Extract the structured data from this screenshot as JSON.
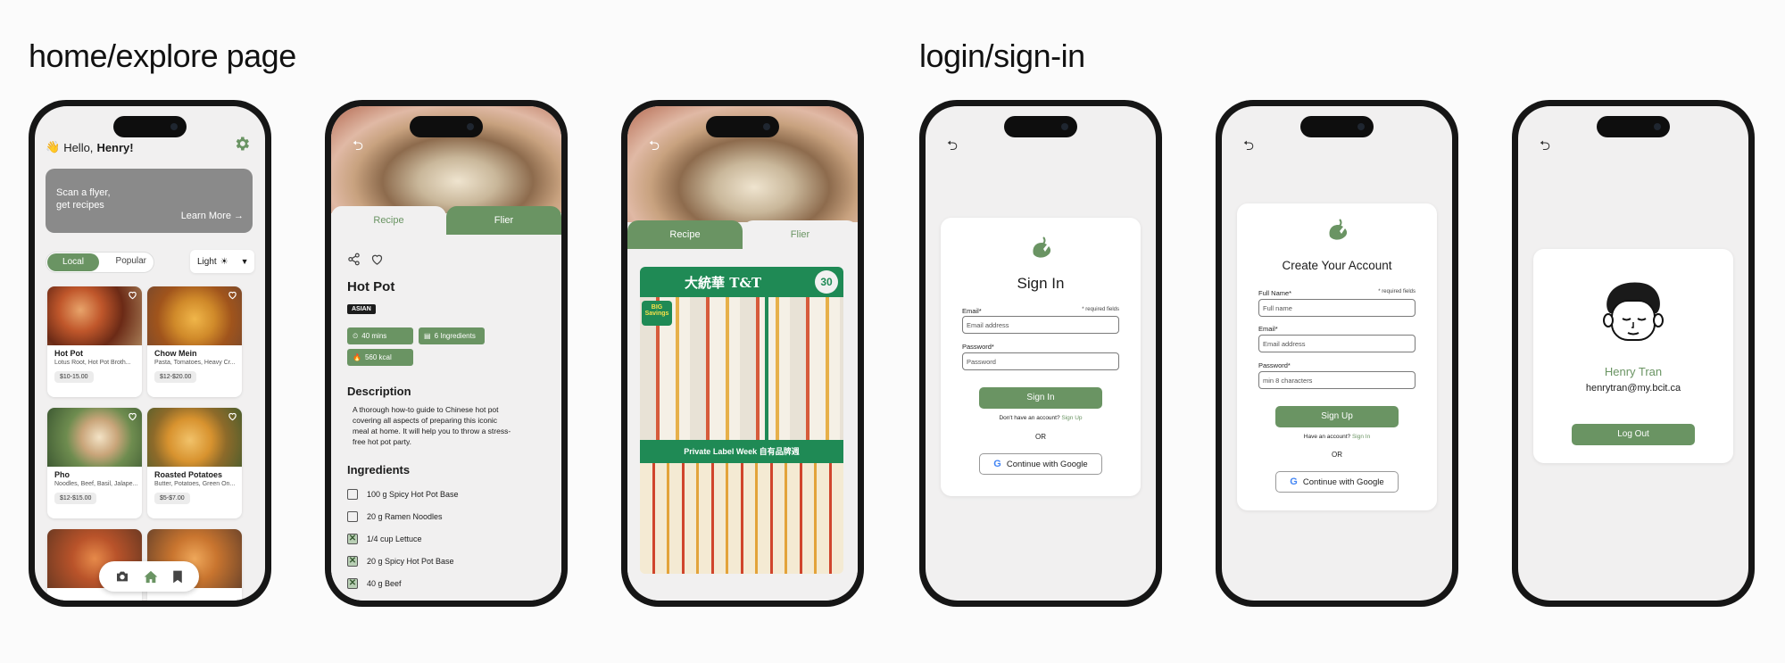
{
  "sections": {
    "home_title": "home/explore page",
    "login_title": "login/sign-in"
  },
  "colors": {
    "accent": "#6a9463",
    "screen_bg": "#f1f0f0",
    "phone_frame": "#161616"
  },
  "home": {
    "greeting_prefix": "Hello, ",
    "greeting_name": "Henry!",
    "banner_line1": "Scan a flyer,",
    "banner_line2": "get recipes",
    "banner_link": "Learn More →",
    "tab_local": "Local",
    "tab_popular": "Popular",
    "theme_label": "Light",
    "cards": [
      {
        "title": "Hot Pot",
        "desc": "Lotus Root, Hot Pot Broth...",
        "price": "$10-15.00"
      },
      {
        "title": "Chow Mein",
        "desc": "Pasta, Tomatoes, Heavy Cr...",
        "price": "$12-$20.00"
      },
      {
        "title": "Pho",
        "desc": "Noodles, Beef, Basil, Jalape...",
        "price": "$12-$15.00"
      },
      {
        "title": "Roasted Potatoes",
        "desc": "Butter, Potatoes, Green On...",
        "price": "$5-$7.00"
      }
    ]
  },
  "recipe": {
    "tab_recipe": "Recipe",
    "tab_flier": "Flier",
    "title": "Hot Pot",
    "tag": "ASIAN",
    "time": "40 mins",
    "ingredients_count": "6 Ingredients",
    "calories": "560 kcal",
    "description_heading": "Description",
    "description": "A thorough how-to guide to Chinese hot pot covering all aspects of preparing this iconic meal at home. It will help you to throw a stress-free hot pot party.",
    "ingredients_heading": "Ingredients",
    "ingredients": [
      {
        "name": "100 g Spicy Hot Pot Base",
        "checked": false
      },
      {
        "name": "20 g Ramen Noodles",
        "checked": false
      },
      {
        "name": "1/4 cup Lettuce",
        "checked": true
      },
      {
        "name": "20 g Spicy Hot Pot Base",
        "checked": true
      },
      {
        "name": "40 g Beef",
        "checked": true
      }
    ]
  },
  "flier": {
    "tab_recipe": "Recipe",
    "tab_flier": "Flier",
    "store_name": "大統華 T&T",
    "banner_text": "Private Label Week 自有品牌週",
    "badge": "BIG Savings",
    "days": "30"
  },
  "signin": {
    "title": "Sign In",
    "email_label": "Email*",
    "required_note": "* required fields",
    "email_placeholder": "Email address",
    "password_label": "Password*",
    "password_placeholder": "Password",
    "button": "Sign In",
    "no_account": "Don't have an account? ",
    "signup_link": "Sign Up",
    "or": "OR",
    "google": "Continue with Google"
  },
  "signup": {
    "title": "Create Your Account",
    "name_label": "Full Name*",
    "required_note": "* required fields",
    "name_placeholder": "Full name",
    "email_label": "Email*",
    "email_placeholder": "Email address",
    "password_label": "Password*",
    "password_placeholder": "min 8 characters",
    "button": "Sign Up",
    "have_account": "Have an account? ",
    "signin_link": "Sign In",
    "or": "OR",
    "google": "Continue with Google"
  },
  "profile": {
    "name": "Henry Tran",
    "email": "henrytran@my.bcit.ca",
    "logout": "Log Out"
  },
  "icons": [
    "wave-hand-icon",
    "gear-icon",
    "sun-icon",
    "chevron-down-icon",
    "heart-icon",
    "camera-icon",
    "home-icon",
    "bookmark-icon",
    "back-icon",
    "share-icon",
    "timer-icon",
    "list-icon",
    "flame-icon",
    "google-icon",
    "leaf-logo-icon"
  ]
}
